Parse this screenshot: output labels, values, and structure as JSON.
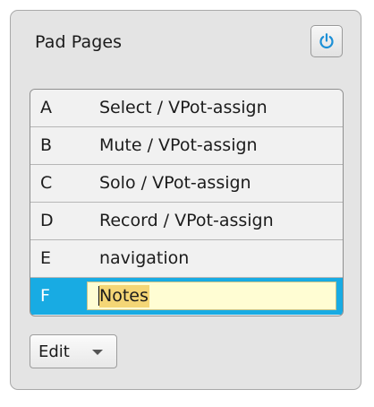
{
  "panel": {
    "title": "Pad Pages",
    "power_icon": "power-icon",
    "accent_color": "#18abe3"
  },
  "pages": [
    {
      "letter": "A",
      "name": "Select / VPot-assign"
    },
    {
      "letter": "B",
      "name": "Mute / VPot-assign"
    },
    {
      "letter": "C",
      "name": "Solo / VPot-assign"
    },
    {
      "letter": "D",
      "name": "Record / VPot-assign"
    },
    {
      "letter": "E",
      "name": "navigation"
    },
    {
      "letter": "F",
      "name": "Notes"
    }
  ],
  "selected_index": 5,
  "edit_menu": {
    "label": "Edit",
    "icon": "chevron-down-icon"
  }
}
